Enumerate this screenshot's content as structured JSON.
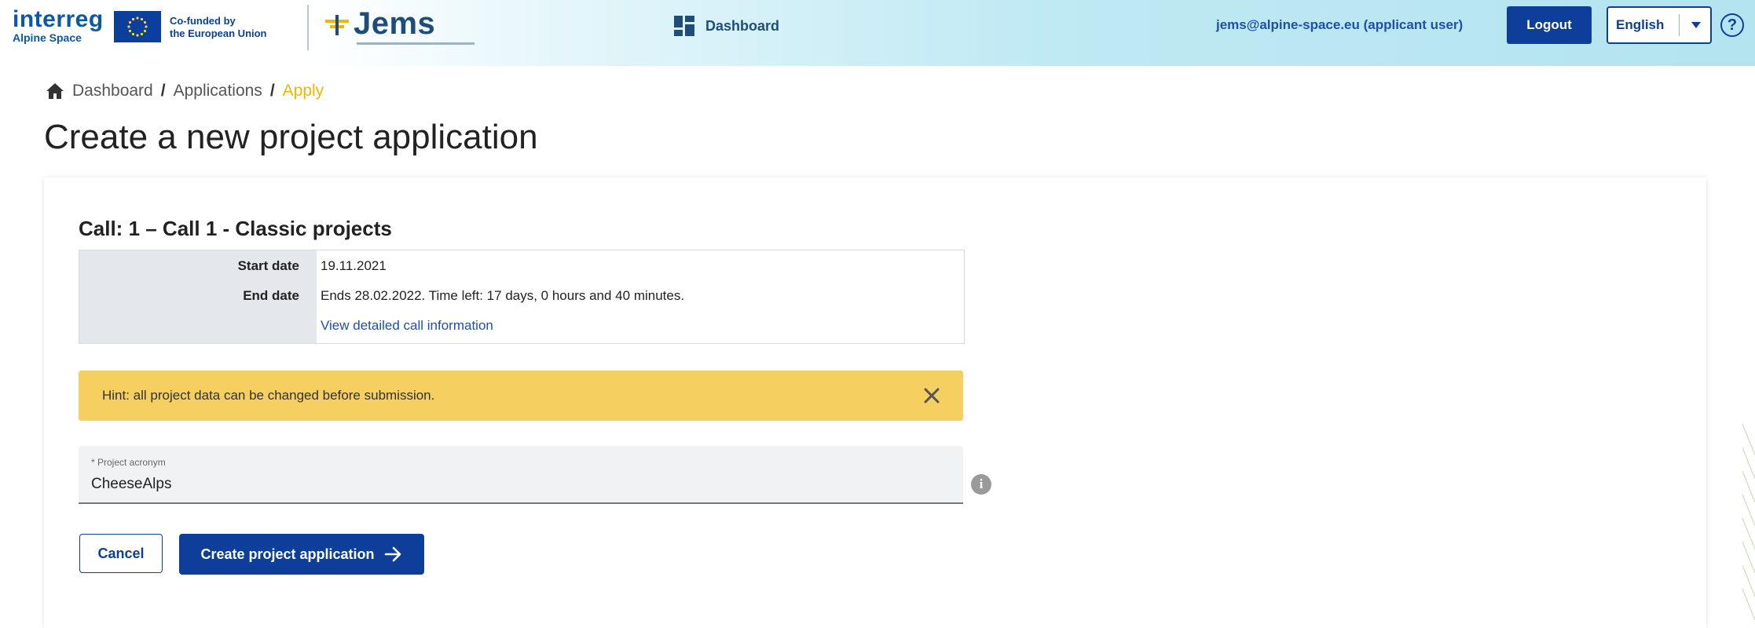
{
  "header": {
    "interreg_word": "interreg",
    "interreg_sub": "Alpine Space",
    "cofunded_line1": "Co-funded by",
    "cofunded_line2": "the European Union",
    "jems_word": "Jems",
    "nav_dashboard": "Dashboard",
    "user_email": "jems@alpine-space.eu (applicant user)",
    "logout_label": "Logout",
    "language": "English",
    "help_symbol": "?"
  },
  "breadcrumb": {
    "items": [
      "Dashboard",
      "Applications",
      "Apply"
    ],
    "separator": "/"
  },
  "page": {
    "title": "Create a new project application"
  },
  "call": {
    "title": "Call: 1 – Call 1 - Classic projects",
    "start_label": "Start date",
    "start_value": "19.11.2021",
    "end_label": "End date",
    "end_value": "Ends 28.02.2022. Time left: 17 days, 0 hours and 40 minutes.",
    "details_link": "View detailed call information"
  },
  "hint": {
    "text": "Hint: all project data can be changed before submission."
  },
  "form": {
    "acronym_label": "* Project acronym",
    "acronym_value": "CheeseAlps",
    "info_symbol": "i"
  },
  "actions": {
    "cancel_label": "Cancel",
    "create_label": "Create project application"
  },
  "colors": {
    "primary": "#0d3f9a",
    "accent_breadcrumb": "#f4b400",
    "hint_bg": "#f5cf5f"
  },
  "icons": {
    "nav": "dashboard-grid-icon",
    "home": "home-icon",
    "close": "close-icon",
    "arrow": "arrow-right-icon",
    "help": "help-circle-icon",
    "info": "info-circle-icon"
  }
}
